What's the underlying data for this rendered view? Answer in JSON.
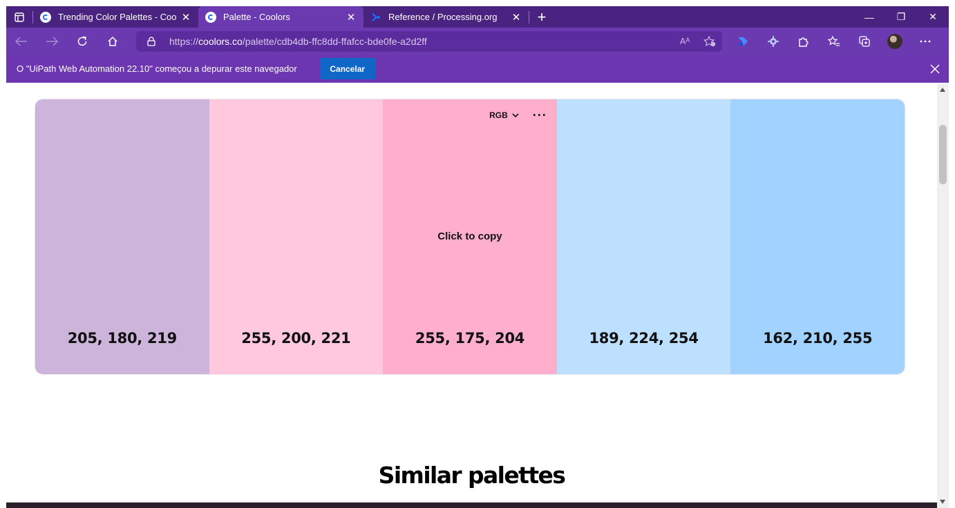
{
  "browser": {
    "tabs": [
      {
        "title": "Trending Color Palettes - Coolors",
        "close": "✕",
        "favicon": "coolors-icon"
      },
      {
        "title": "Palette - Coolors",
        "close": "✕",
        "favicon": "coolors-icon"
      },
      {
        "title": "Reference / Processing.org",
        "close": "✕",
        "favicon": "processing-icon"
      }
    ],
    "newtab": "+",
    "window_controls": {
      "minimize": "—",
      "maximize": "❐",
      "close": "✕"
    },
    "address": {
      "prefix": "https://",
      "host": "coolors.co",
      "path": "/palette/cdb4db-ffc8dd-ffafcc-bde0fe-a2d2ff",
      "read_aloud": "Aᴬ"
    },
    "infobar": {
      "message": "O \"UiPath Web Automation 22.10\" começou a depurar este navegador",
      "cancel_label": "Cancelar",
      "close": "✕"
    }
  },
  "palette": {
    "format_label": "RGB",
    "more_label": "···",
    "copy_hint": "Click to copy",
    "swatches": [
      {
        "hex": "#cdb4db",
        "rgb": "205, 180, 219"
      },
      {
        "hex": "#ffc8dd",
        "rgb": "255, 200, 221"
      },
      {
        "hex": "#ffafcc",
        "rgb": "255, 175, 204"
      },
      {
        "hex": "#bde0fe",
        "rgb": "189, 224, 254"
      },
      {
        "hex": "#a2d2ff",
        "rgb": "162, 210, 255"
      }
    ]
  },
  "similar_title": "Similar palettes",
  "colors": {
    "tabstrip": "#4a2381",
    "toolbar": "#6b3ab0",
    "cancel_button": "#1167c8"
  }
}
